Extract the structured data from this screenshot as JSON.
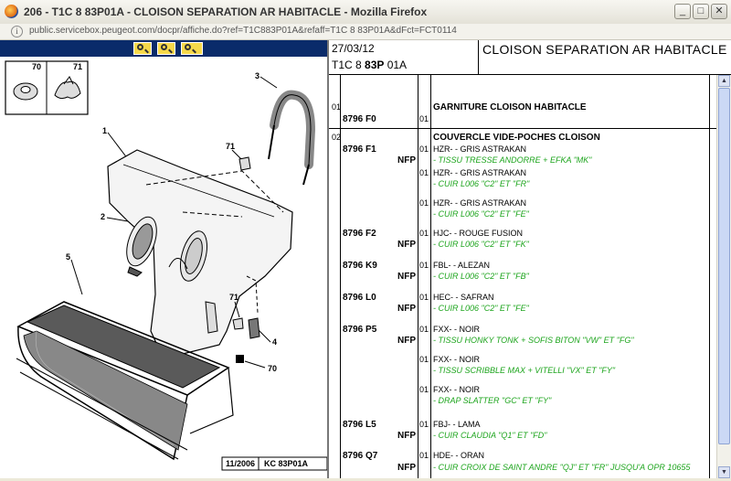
{
  "window": {
    "title": "206 - T1C 8 83P01A - CLOISON SEPARATION AR HABITACLE - Mozilla Firefox",
    "url": "public.servicebox.peugeot.com/docpr/affiche.do?ref=T1C883P01A&refaff=T1C 8 83P01A&dFct=FCT0114",
    "minimize": "_",
    "maximize": "□",
    "close": "✕"
  },
  "diagram": {
    "callouts": [
      "70",
      "71",
      "3",
      "1",
      "71",
      "2",
      "5",
      "71",
      "4",
      "70"
    ],
    "date": "11/2006",
    "ref": "KC 83P01A"
  },
  "header": {
    "date": "27/03/12",
    "code_a": "T1C 8 ",
    "code_b": "83P",
    "code_c": " 01A",
    "title": "CLOISON SEPARATION AR HABITACLE"
  },
  "groups": [
    {
      "num": "01",
      "title": "GARNITURE CLOISON HABITACLE"
    },
    {
      "num": "02",
      "title": "COUVERCLE VIDE-POCHES CLOISON"
    }
  ],
  "items": [
    {
      "code": "8796 F0",
      "nfp": "",
      "qty": "01",
      "desc": "",
      "spec": ""
    },
    {
      "code": "8796 F1",
      "nfp": "NFP",
      "qty": "01",
      "desc": "HZR- - GRIS ASTRAKAN",
      "spec": "- TISSU TRESSE ANDORRE + EFKA \"MK\""
    },
    {
      "code": "",
      "nfp": "",
      "qty": "01",
      "desc": "HZR- - GRIS ASTRAKAN",
      "spec": "- CUIR L006 \"C2\" ET \"FR\""
    },
    {
      "code": "",
      "nfp": "",
      "qty": "01",
      "desc": "HZR- - GRIS ASTRAKAN",
      "spec": "- CUIR L006 \"C2\" ET \"FE\""
    },
    {
      "code": "8796 F2",
      "nfp": "NFP",
      "qty": "01",
      "desc": "HJC- - ROUGE FUSION",
      "spec": "- CUIR L006 \"C2\" ET \"FK\""
    },
    {
      "code": "8796 K9",
      "nfp": "NFP",
      "qty": "01",
      "desc": "FBL- - ALEZAN",
      "spec": "- CUIR L006 \"C2\" ET \"FB\""
    },
    {
      "code": "8796 L0",
      "nfp": "NFP",
      "qty": "01",
      "desc": "HEC- - SAFRAN",
      "spec": "- CUIR L006 \"C2\" ET \"FE\""
    },
    {
      "code": "8796 P5",
      "nfp": "NFP",
      "qty": "01",
      "desc": "FXX- - NOIR",
      "spec": "- TISSU HONKY TONK + SOFIS BITON \"VW\" ET \"FG\""
    },
    {
      "code": "",
      "nfp": "",
      "qty": "01",
      "desc": "FXX- - NOIR",
      "spec": "- TISSU SCRIBBLE MAX + VITELLI \"VX\" ET \"FY\""
    },
    {
      "code": "",
      "nfp": "",
      "qty": "01",
      "desc": "FXX- - NOIR",
      "spec": "- DRAP SLATTER \"GC\" ET \"FY\""
    },
    {
      "code": "8796 L5",
      "nfp": "NFP",
      "qty": "01",
      "desc": "FBJ- - LAMA",
      "spec": "- CUIR CLAUDIA \"Q1\" ET \"FD\""
    },
    {
      "code": "8796 Q7",
      "nfp": "NFP",
      "qty": "01",
      "desc": "HDE- - ORAN",
      "spec": "- CUIR CROIX DE SAINT ANDRE \"QJ\" ET \"FR\" JUSQU'A OPR 10655"
    }
  ],
  "colors": {
    "toolbar": "#0a2b6a",
    "zoom_button": "#f6d84a",
    "spec_text": "#1ea51e"
  }
}
